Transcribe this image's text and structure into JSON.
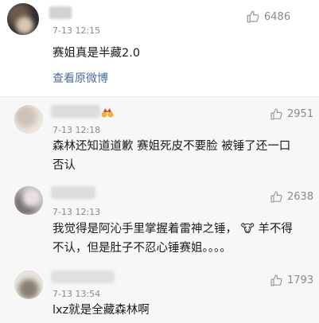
{
  "main_comment": {
    "timestamp": "7-13 12:15",
    "text": "赛姐真是半藏2.0",
    "likes": "6486",
    "view_original": "查看原微博"
  },
  "replies": [
    {
      "timestamp": "7-13 12:18",
      "text_line1": "森林还知道道歉 赛姐死皮不要脸 被锤了还一口",
      "text_line2": "否认",
      "likes": "2951"
    },
    {
      "timestamp": "7-13 12:13",
      "text_line1": "我觉得是阿沁手里掌握着雷神之锤， 🐮 羊不得",
      "text_line2": "不认，但是肚子不忍心锤赛姐。。。。",
      "likes": "2638"
    },
    {
      "timestamp": "7-13 13:54",
      "text_line1": "lxz就是全藏森林啊",
      "likes": "1793"
    }
  ],
  "icons": {
    "like": "thumbs-up-icon",
    "badge": "vip-crown-icon"
  },
  "colors": {
    "link": "#4a6d9a",
    "muted": "#8a8a8a",
    "reply_bg": "#f7f7f7"
  }
}
